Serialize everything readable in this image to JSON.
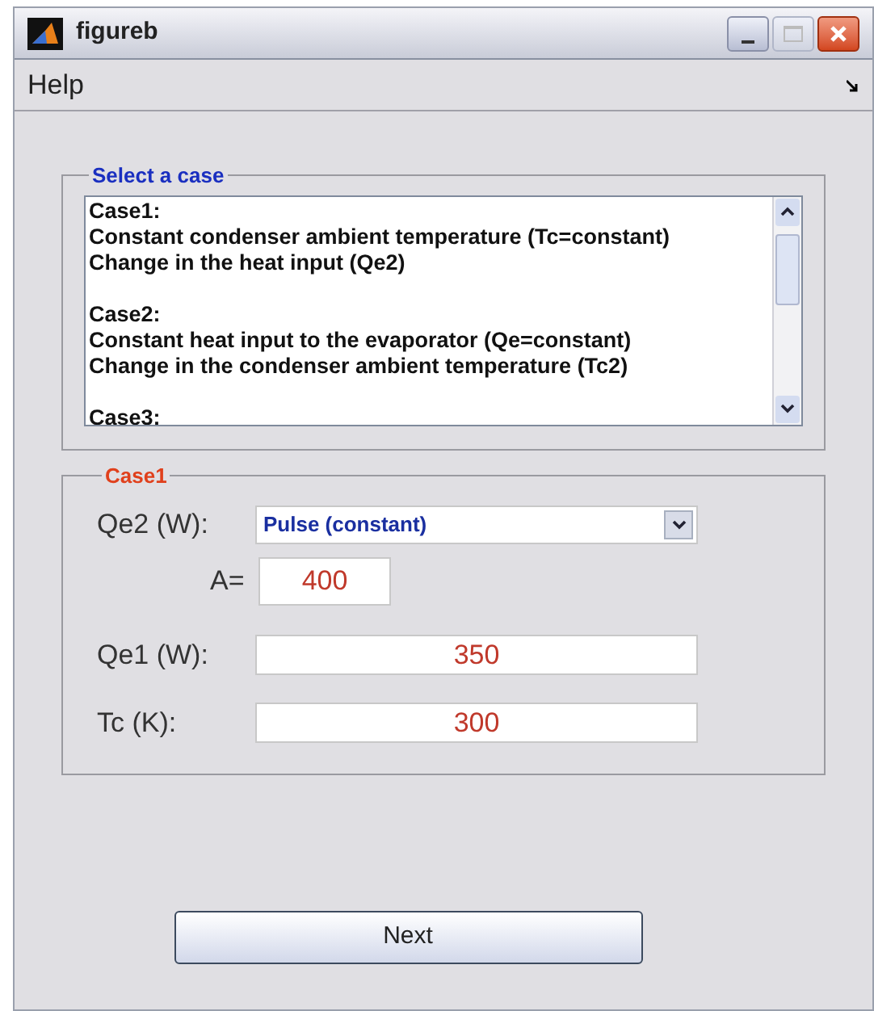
{
  "window": {
    "title": "figureb"
  },
  "menu": [
    "Help"
  ],
  "case_list": {
    "title": "Select a case",
    "lines": [
      {
        "lines": [
          "Case1:",
          "Constant condenser ambient temperature (Tc=constant)",
          "Change in the heat input (Qe2)"
        ]
      },
      {
        "lines": [
          "Case2:",
          "Constant heat input to the evaporator (Qe=constant)",
          "Change in the condenser ambient temperature (Tc2)"
        ]
      },
      {
        "lines": [
          "Case3:"
        ]
      }
    ]
  },
  "case_panel": {
    "title": "Case1",
    "qe2": {
      "label": "Qe2 (W):",
      "value": "Pulse (constant)"
    },
    "amplitude": {
      "label": "A=",
      "value": "400"
    },
    "qe1": {
      "label": "Qe1 (W):",
      "value": "350"
    },
    "tc": {
      "label": "Tc (K):",
      "value": "300"
    }
  },
  "buttons": [
    "Next"
  ]
}
